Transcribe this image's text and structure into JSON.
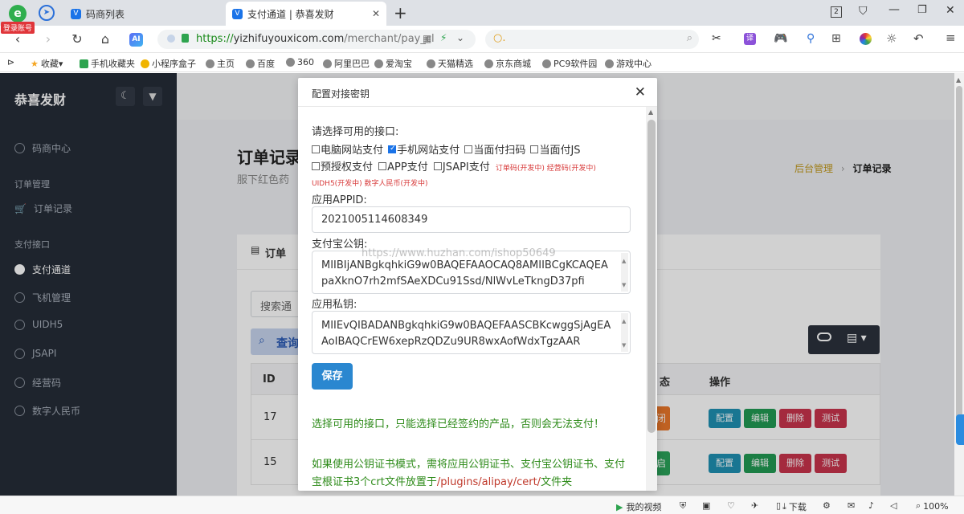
{
  "browser": {
    "login_badge": "登录账号",
    "tabs": [
      {
        "title": "码商列表"
      },
      {
        "title": "支付通道 | 恭喜发财"
      }
    ],
    "url_scheme": "https://",
    "url_host": "yizhifuyouxicom.com",
    "url_path": "/merchant/pay_cl",
    "search_placeholder": "○.",
    "bookmarks": [
      "收藏",
      "手机收藏夹",
      "小程序盒子",
      "主页",
      "百度",
      "360",
      "阿里巴巴",
      "爱淘宝",
      "天猫精选",
      "京东商城",
      "PC9软件园",
      "游戏中心"
    ]
  },
  "sidebar": {
    "brand": "恭喜发财",
    "items": [
      {
        "type": "item",
        "label": "码商中心"
      },
      {
        "type": "section",
        "label": "订单管理"
      },
      {
        "type": "item",
        "label": "订单记录"
      },
      {
        "type": "section",
        "label": "支付接口"
      },
      {
        "type": "item",
        "label": "支付通道",
        "active": true
      },
      {
        "type": "item",
        "label": "飞机管理"
      },
      {
        "type": "item",
        "label": "UIDH5"
      },
      {
        "type": "item",
        "label": "JSAPI"
      },
      {
        "type": "item",
        "label": "经营码"
      },
      {
        "type": "item",
        "label": "数字人民币"
      }
    ]
  },
  "main": {
    "page_title": "订单记录",
    "page_subtitle": "服下红色药",
    "breadcrumb_home": "后台管理",
    "breadcrumb_current": "订单记录",
    "panel_title": "订单",
    "search_placeholder": "搜索通",
    "query_label": "查询",
    "table": {
      "headers": [
        "ID",
        "态",
        "操作"
      ],
      "rows": [
        {
          "id": "17",
          "status": "关闭",
          "status_color": "#e9772a"
        },
        {
          "id": "15",
          "status": "开启",
          "status_color": "#2aa35a"
        }
      ],
      "actions": [
        {
          "label": "配置",
          "color": "#1f91b3"
        },
        {
          "label": "编辑",
          "color": "#229a54"
        },
        {
          "label": "删除",
          "color": "#c9344c"
        },
        {
          "label": "测试",
          "color": "#c9344c"
        }
      ]
    }
  },
  "modal": {
    "title": "配置对接密钥",
    "interfaces_label": "请选择可用的接口:",
    "interfaces": [
      {
        "label": "电脑网站支付",
        "checked": false
      },
      {
        "label": "手机网站支付",
        "checked": true
      },
      {
        "label": "当面付扫码",
        "checked": false
      },
      {
        "label": "当面付JS",
        "checked": false
      },
      {
        "label": "预授权支付",
        "checked": false
      },
      {
        "label": "APP支付",
        "checked": false
      },
      {
        "label": "JSAPI支付",
        "checked": false
      }
    ],
    "dev_note_1": "订单码(开发中) 经营码(开发中)",
    "dev_note_2": "UIDH5(开发中) 数字人民币(开发中)",
    "appid_label": "应用APPID:",
    "appid_value": "2021005114608349",
    "pubkey_label": "支付宝公钥:",
    "pubkey_value": "MIIBIjANBgkqhkiG9w0BAQEFAAOCAQ8AMIIBCgKCAQEApaXknO7rh2mfSAeXDCu91Ssd/NlWvLeTkngD37pfi",
    "privkey_label": "应用私钥:",
    "privkey_value": "MIIEvQIBADANBgkqhkiG9w0BAQEFAASCBKcwggSjAgEAAoIBAQCrEW6xepRzQDZu9UR8wxAofWdxTgzAAR",
    "save_label": "保存",
    "note_1": "选择可用的接口，只能选择已经签约的产品，否则会无法支付！",
    "note_2_a": "如果使用公钥证书模式，需将应用公钥证书、支付宝公钥证书、支付宝根证书3个crt文件放置于",
    "note_2_path": "/plugins/alipay/cert/",
    "note_2_b": "文件夹",
    "watermark": "https://www.huzhan.com/ishop50649"
  },
  "statusbar": {
    "video": "我的视频",
    "download": "下载",
    "zoom": "100%"
  }
}
